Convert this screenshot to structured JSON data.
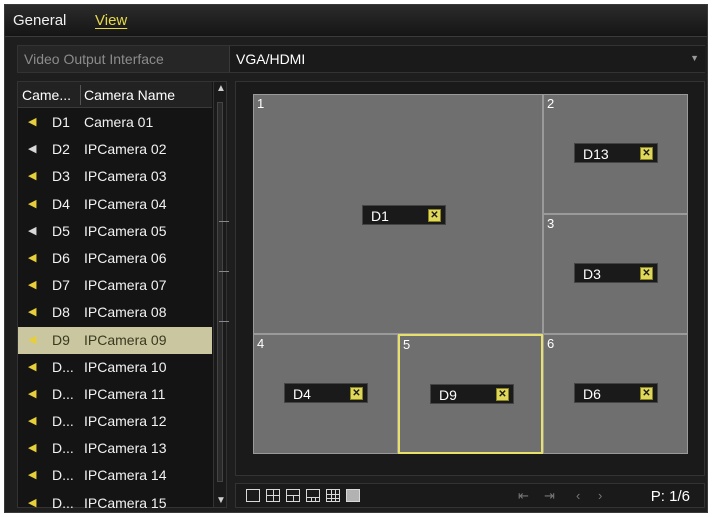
{
  "tabs": {
    "general": "General",
    "view": "View"
  },
  "output": {
    "label": "Video Output Interface",
    "value": "VGA/HDMI"
  },
  "camera_list": {
    "header_no": "Came...",
    "header_name": "Camera Name",
    "rows": [
      {
        "no": "D1",
        "name": "Camera 01",
        "icon": "camera-icon-active"
      },
      {
        "no": "D2",
        "name": "IPCamera 02",
        "icon": "camera-icon-inactive"
      },
      {
        "no": "D3",
        "name": "IPCamera 03",
        "icon": "camera-icon-active"
      },
      {
        "no": "D4",
        "name": "IPCamera 04",
        "icon": "camera-icon-active"
      },
      {
        "no": "D5",
        "name": "IPCamera 05",
        "icon": "camera-icon-inactive"
      },
      {
        "no": "D6",
        "name": "IPCamera 06",
        "icon": "camera-icon-active"
      },
      {
        "no": "D7",
        "name": "IPCamera 07",
        "icon": "camera-icon-active"
      },
      {
        "no": "D8",
        "name": "IPCamera 08",
        "icon": "camera-icon-active"
      },
      {
        "no": "D9",
        "name": "IPCamera 09",
        "icon": "camera-icon-active",
        "selected": true
      },
      {
        "no": "D...",
        "name": "IPCamera 10",
        "icon": "camera-icon-active"
      },
      {
        "no": "D...",
        "name": "IPCamera 11",
        "icon": "camera-icon-active"
      },
      {
        "no": "D...",
        "name": "IPCamera 12",
        "icon": "camera-icon-active"
      },
      {
        "no": "D...",
        "name": "IPCamera 13",
        "icon": "camera-icon-active"
      },
      {
        "no": "D...",
        "name": "IPCamera 14",
        "icon": "camera-icon-active"
      },
      {
        "no": "D...",
        "name": "IPCamera 15",
        "icon": "camera-icon-active"
      }
    ]
  },
  "windows": [
    {
      "num": "1",
      "camera": "D1"
    },
    {
      "num": "2",
      "camera": "D13"
    },
    {
      "num": "3",
      "camera": "D3"
    },
    {
      "num": "4",
      "camera": "D4"
    },
    {
      "num": "5",
      "camera": "D9",
      "selected": true
    },
    {
      "num": "6",
      "camera": "D6"
    }
  ],
  "close_glyph": "✕",
  "toolbar": {
    "layouts": [
      "layout-1-icon",
      "layout-4-icon",
      "layout-6-icon",
      "layout-8-icon",
      "layout-9-icon",
      "layout-16-icon"
    ],
    "page": "P: 1/6"
  },
  "colors": {
    "accent": "#e6d84a",
    "selected_border": "#e8e06a",
    "window_bg": "#6f6f6f"
  }
}
